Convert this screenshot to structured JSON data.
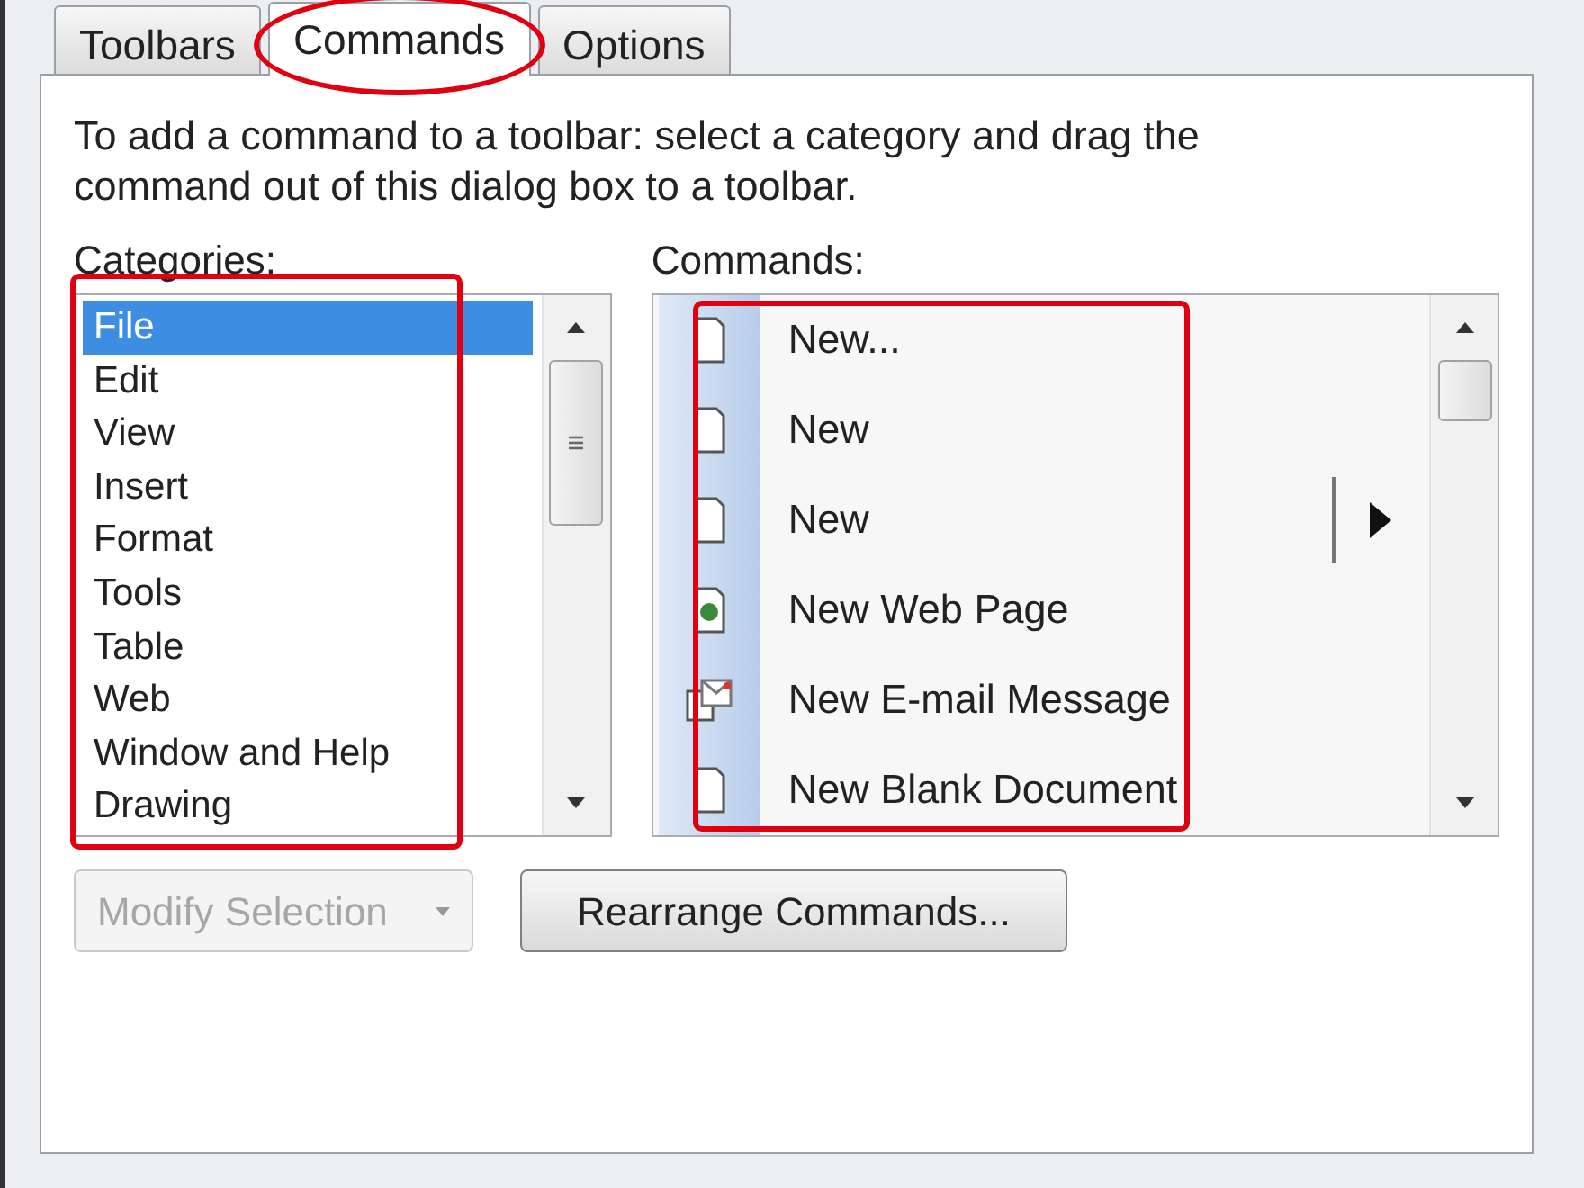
{
  "tabs": [
    {
      "label": "Toolbars",
      "selected": false,
      "circled": false
    },
    {
      "label": "Commands",
      "selected": true,
      "circled": true
    },
    {
      "label": "Options",
      "selected": false,
      "circled": false
    }
  ],
  "instructions": "To add a command to a toolbar: select a category and drag the command out of this dialog box to a toolbar.",
  "categories": {
    "label": "Categories:",
    "outlined": true,
    "items": [
      {
        "label": "File",
        "selected": true
      },
      {
        "label": "Edit",
        "selected": false
      },
      {
        "label": "View",
        "selected": false
      },
      {
        "label": "Insert",
        "selected": false
      },
      {
        "label": "Format",
        "selected": false
      },
      {
        "label": "Tools",
        "selected": false
      },
      {
        "label": "Table",
        "selected": false
      },
      {
        "label": "Web",
        "selected": false
      },
      {
        "label": "Window and Help",
        "selected": false
      },
      {
        "label": "Drawing",
        "selected": false
      }
    ]
  },
  "commands": {
    "label": "Commands:",
    "outlined": true,
    "items": [
      {
        "label": "New...",
        "kind": "document",
        "submenu": false
      },
      {
        "label": "New",
        "kind": "document",
        "submenu": false
      },
      {
        "label": "New",
        "kind": "document",
        "submenu": true
      },
      {
        "label": "New Web Page",
        "kind": "web-page",
        "submenu": false
      },
      {
        "label": "New E-mail Message",
        "kind": "email",
        "submenu": false
      },
      {
        "label": "New Blank Document",
        "kind": "document",
        "submenu": false
      }
    ]
  },
  "buttons": [
    {
      "label": "Modify Selection",
      "kind": "dropdown",
      "disabled": true
    },
    {
      "label": "Rearrange Commands...",
      "kind": "button",
      "disabled": false
    }
  ]
}
